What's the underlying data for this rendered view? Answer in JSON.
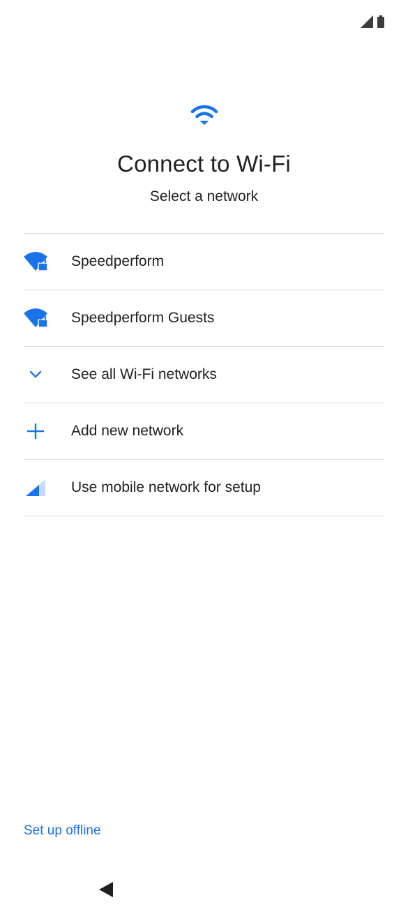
{
  "status_bar": {
    "icons": [
      "cellular-signal-icon",
      "battery-icon"
    ]
  },
  "header": {
    "icon": "wifi-icon",
    "title": "Connect to Wi-Fi",
    "subtitle": "Select a network"
  },
  "networks": [
    {
      "icon": "wifi-locked-icon",
      "label": "Speedperform"
    },
    {
      "icon": "wifi-locked-icon",
      "label": "Speedperform Guests"
    },
    {
      "icon": "chevron-down-icon",
      "label": "See all Wi-Fi networks"
    },
    {
      "icon": "plus-icon",
      "label": "Add new network"
    },
    {
      "icon": "cellular-signal-icon",
      "label": "Use mobile network for setup"
    }
  ],
  "footer": {
    "offline_label": "Set up offline"
  },
  "nav": {
    "back_icon": "back-triangle-icon"
  },
  "colors": {
    "accent": "#1a73e8",
    "text": "#1f1f1f",
    "divider": "#dadada"
  }
}
